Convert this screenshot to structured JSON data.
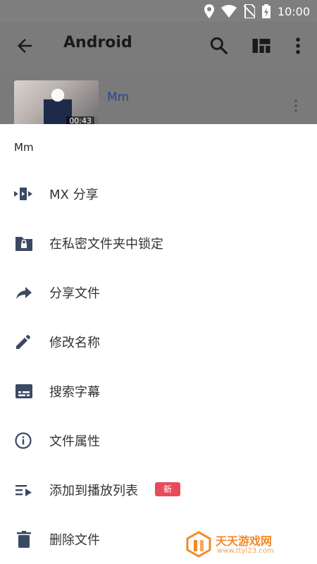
{
  "status_bar": {
    "time": "10:00",
    "icons": [
      "location-icon",
      "wifi-icon",
      "no-sim-icon",
      "battery-charging-icon"
    ]
  },
  "toolbar": {
    "title": "Android",
    "icons": [
      "back-arrow-icon",
      "search-icon",
      "layout-icon",
      "more-vert-icon"
    ]
  },
  "video": {
    "title": "Mm",
    "duration": "00:43"
  },
  "sheet": {
    "header": "Mm",
    "items": [
      {
        "label": "MX 分享",
        "icon": "mx-share-icon"
      },
      {
        "label": "在私密文件夹中锁定",
        "icon": "locked-folder-icon"
      },
      {
        "label": "分享文件",
        "icon": "share-arrow-icon"
      },
      {
        "label": "修改名称",
        "icon": "pencil-icon"
      },
      {
        "label": "搜索字幕",
        "icon": "subtitles-icon"
      },
      {
        "label": "文件属性",
        "icon": "info-icon"
      },
      {
        "label": "添加到播放列表",
        "icon": "playlist-add-icon",
        "badge": "新"
      },
      {
        "label": "删除文件",
        "icon": "trash-icon"
      }
    ]
  },
  "watermark": {
    "name": "天天游戏网",
    "url": "www.ttyl23.com"
  },
  "colors": {
    "icon": "#3b4a63",
    "badge": "#e74b5b",
    "link": "#26469a"
  }
}
